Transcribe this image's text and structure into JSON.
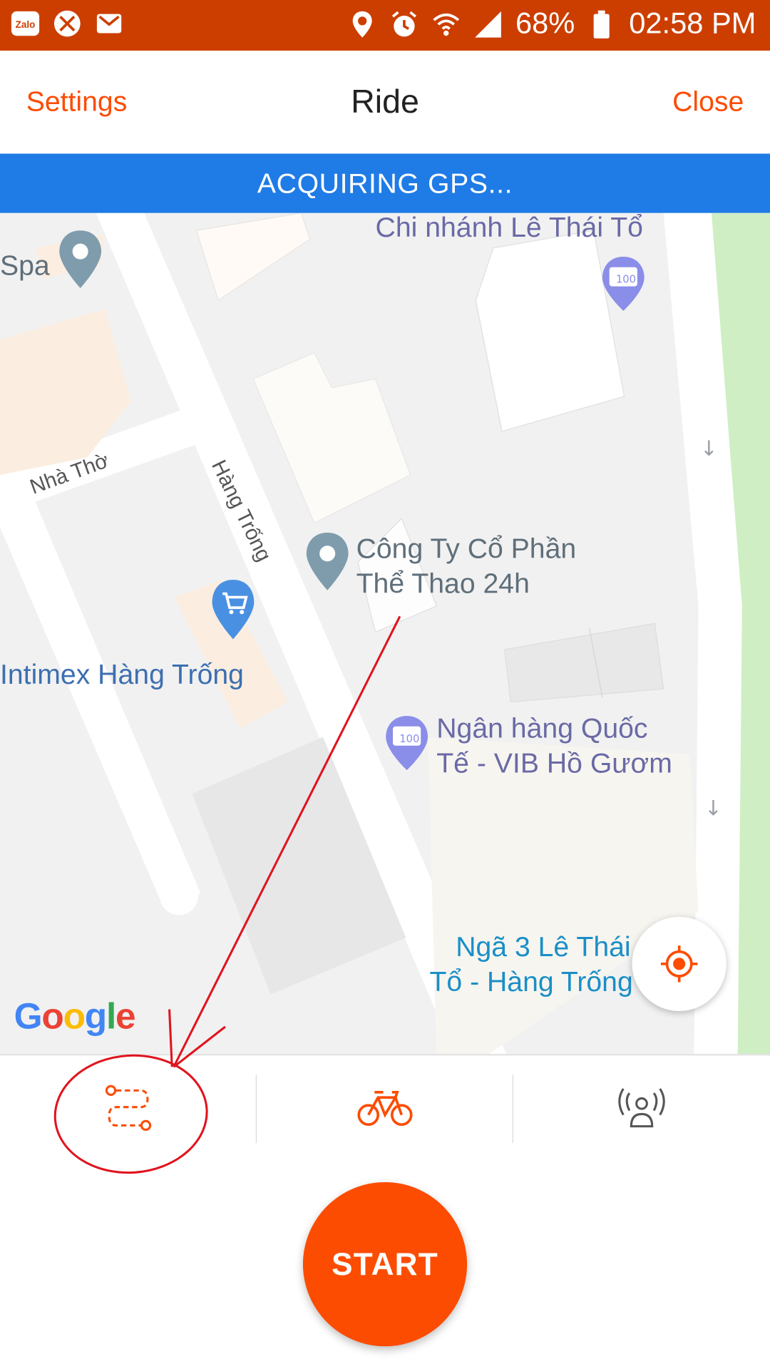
{
  "status_bar": {
    "battery": "68%",
    "time": "02:58 PM",
    "left_icons": [
      "zalo-icon",
      "missed-call-icon",
      "gmail-icon"
    ],
    "right_icons": [
      "location-icon",
      "alarm-icon",
      "wifi-icon",
      "signal-icon",
      "battery-icon"
    ]
  },
  "header": {
    "settings_label": "Settings",
    "title": "Ride",
    "close_label": "Close"
  },
  "banner": {
    "text": "ACQUIRING GPS..."
  },
  "map": {
    "labels": {
      "chi_nhanh": "Chi nhánh Lê Thái Tổ",
      "spa": "Spa",
      "nha_tho": "Nhà Thờ",
      "hang_trong": "Hàng Trống",
      "cong_ty_line1": "Công Ty Cổ Phần",
      "cong_ty_line2": "Thể Thao 24h",
      "intimex": "Intimex Hàng Trống",
      "ngan_hang_line1": "Ngân hàng Quốc",
      "ngan_hang_line2": "Tế - VIB Hồ Gươm",
      "nga3_line1": "Ngã 3 Lê Thái",
      "nga3_line2": "Tổ - Hàng Trống"
    },
    "google_logo": [
      "G",
      "o",
      "o",
      "g",
      "l",
      "e"
    ],
    "atm_badge": "100"
  },
  "tabs": [
    {
      "icon": "route-icon"
    },
    {
      "icon": "bike-icon"
    },
    {
      "icon": "beacon-icon"
    }
  ],
  "start_label": "START",
  "colors": {
    "brand": "#fc4c02",
    "status_bar": "#cc3e00",
    "banner": "#1f7be6",
    "annotation": "#e0141e"
  }
}
